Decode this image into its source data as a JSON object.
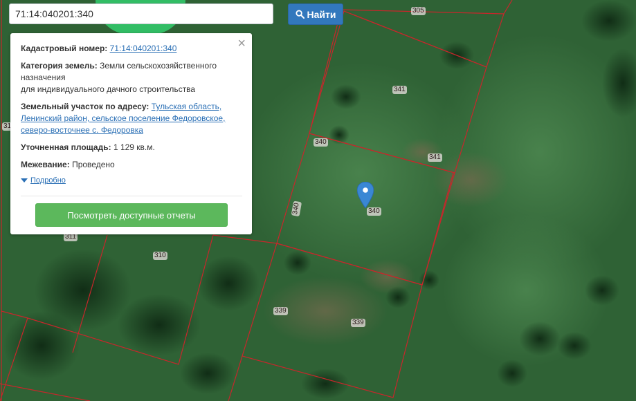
{
  "search": {
    "value": "71:14:040201:340",
    "button_label": "Найти"
  },
  "popup": {
    "cadastral_label": "Кадастровый номер:",
    "cadastral_value": "71:14:040201:340",
    "category_label": "Категория земель:",
    "category_value_1": "Земли сельскохозяйственного",
    "category_value_2": "назначения",
    "category_value_3": "для индивидуального дачного строительства",
    "address_label": "Земельный участок по адресу:",
    "address_value_1": "Тульская область,",
    "address_value_2": "Ленинский район, сельское поселение Федоровское,",
    "address_value_3": "северо-восточнее с. Федоровка",
    "area_label": "Уточненная площадь:",
    "area_value": "1 129 кв.м.",
    "survey_label": "Межевание:",
    "survey_value": "Проведено",
    "more_label": "Подробно",
    "report_button": "Посмотреть доступные отчеты",
    "close_symbol": "×"
  },
  "parcel_labels": {
    "l305": "305",
    "l341a": "341",
    "l340a": "340",
    "l341b": "341",
    "l340b": "340",
    "l340c": "340",
    "l311a": "311",
    "l311b": "31",
    "l310": "310",
    "l339a": "339",
    "l339b": "339"
  },
  "colors": {
    "parcel_border": "#c8262b",
    "marker": "#3a87d4",
    "button_primary": "#3278bd",
    "button_success": "#5cb85c"
  },
  "icons": {
    "search": "search-icon",
    "marker": "map-marker-icon",
    "close": "close-icon",
    "expand": "caret-down-icon"
  }
}
